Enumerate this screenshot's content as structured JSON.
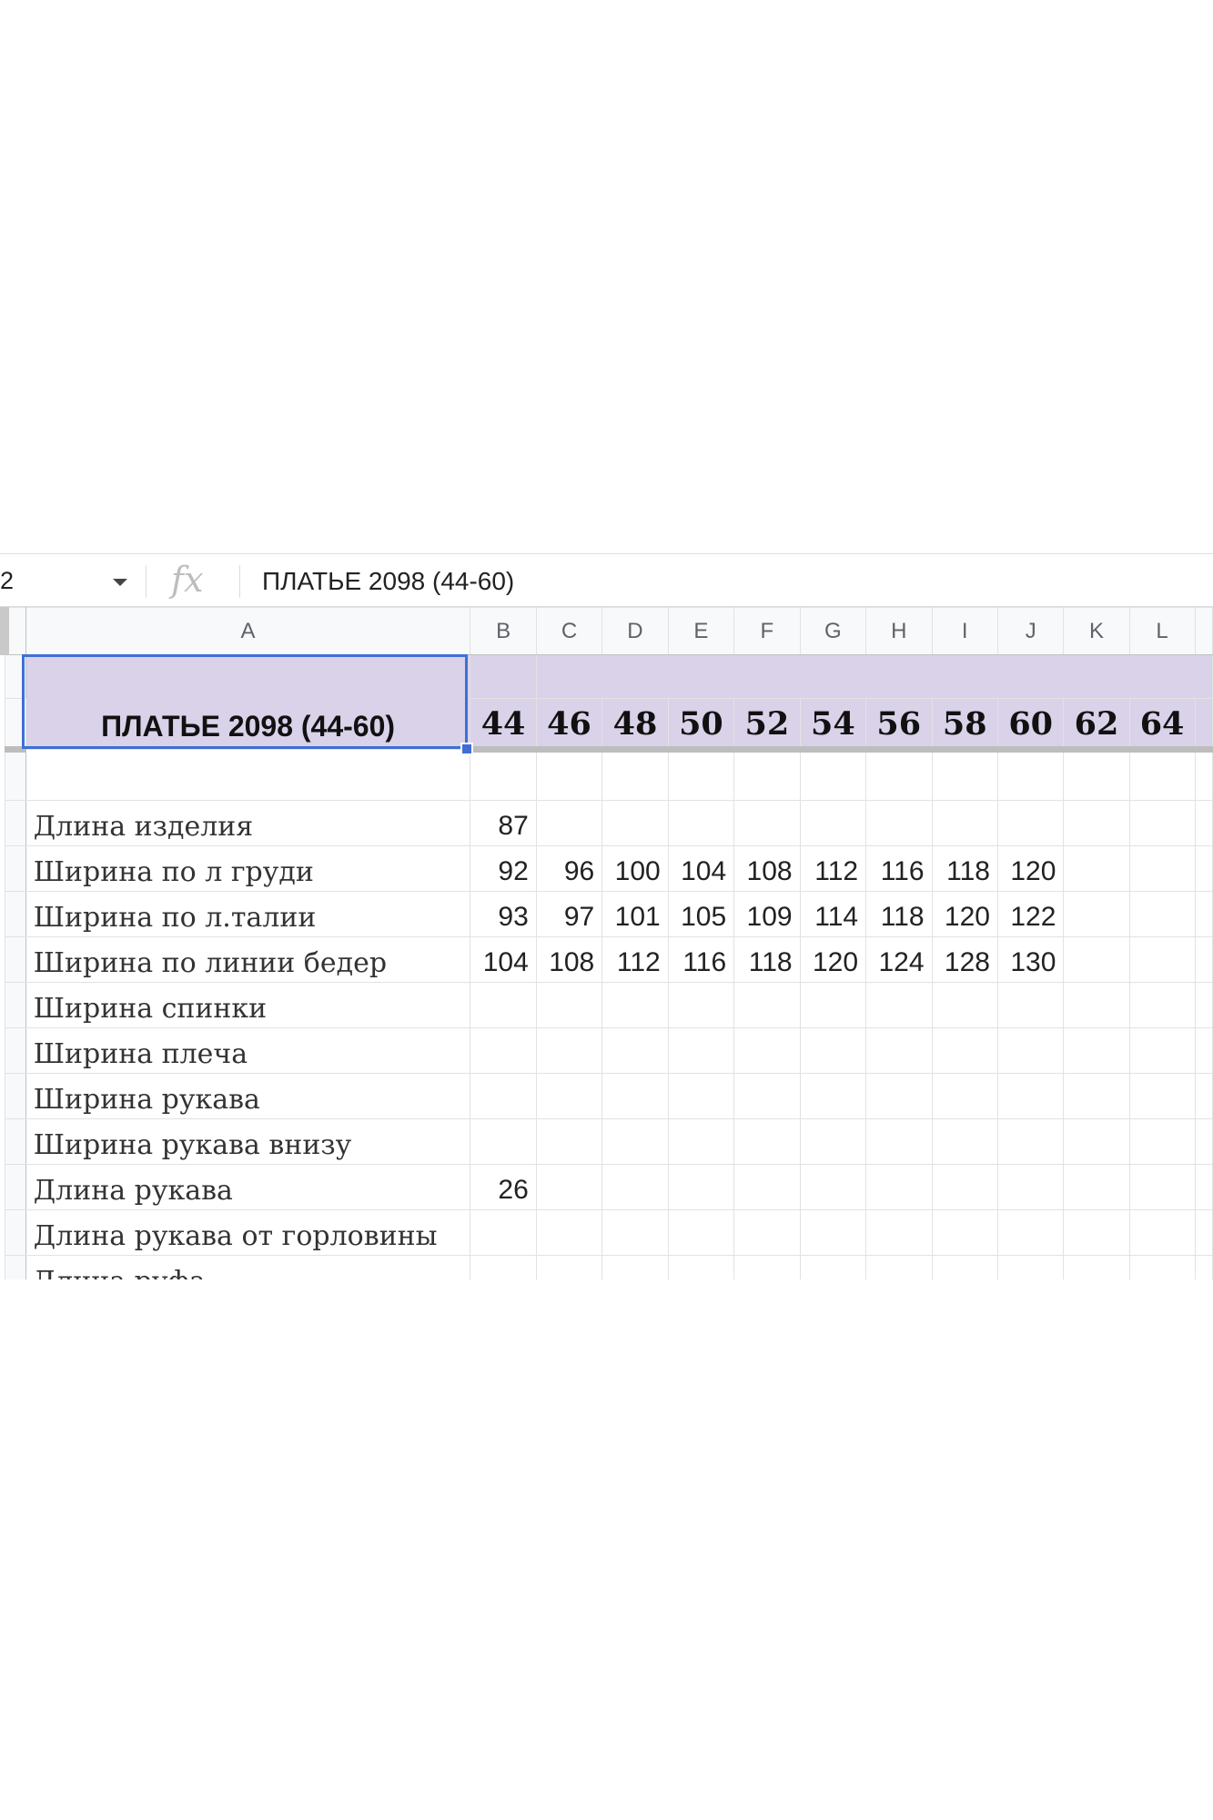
{
  "formula_bar": {
    "name_box": "2",
    "fx_label": "fx",
    "formula": "ПЛАТЬЕ 2098 (44-60)"
  },
  "columns": [
    "A",
    "B",
    "C",
    "D",
    "E",
    "F",
    "G",
    "H",
    "I",
    "J",
    "K",
    "L"
  ],
  "header": {
    "title": "ПЛАТЬЕ 2098 (44-60)",
    "sizes": [
      "44",
      "46",
      "48",
      "50",
      "52",
      "54",
      "56",
      "58",
      "60",
      "62",
      "64"
    ]
  },
  "rows": [
    {
      "label": "Длина изделия",
      "values": [
        "87",
        "",
        "",
        "",
        "",
        "",
        "",
        "",
        "",
        "",
        ""
      ]
    },
    {
      "label": "Ширина по л груди",
      "values": [
        "92",
        "96",
        "100",
        "104",
        "108",
        "112",
        "116",
        "118",
        "120",
        "",
        ""
      ]
    },
    {
      "label": "Ширина по л.талии",
      "values": [
        "93",
        "97",
        "101",
        "105",
        "109",
        "114",
        "118",
        "120",
        "122",
        "",
        ""
      ]
    },
    {
      "label": "Ширина по линии бедер",
      "values": [
        "104",
        "108",
        "112",
        "116",
        "118",
        "120",
        "124",
        "128",
        "130",
        "",
        ""
      ]
    },
    {
      "label": "Ширина спинки",
      "values": [
        "",
        "",
        "",
        "",
        "",
        "",
        "",
        "",
        "",
        "",
        ""
      ]
    },
    {
      "label": "Ширина плеча",
      "values": [
        "",
        "",
        "",
        "",
        "",
        "",
        "",
        "",
        "",
        "",
        ""
      ]
    },
    {
      "label": " Ширина рукава",
      "values": [
        "",
        "",
        "",
        "",
        "",
        "",
        "",
        "",
        "",
        "",
        ""
      ]
    },
    {
      "label": "Ширина рукава внизу",
      "values": [
        "",
        "",
        "",
        "",
        "",
        "",
        "",
        "",
        "",
        "",
        ""
      ]
    },
    {
      "label": "Длина рукава",
      "values": [
        "26",
        "",
        "",
        "",
        "",
        "",
        "",
        "",
        "",
        "",
        ""
      ]
    },
    {
      "label": "Длина рукава  от горловины",
      "values": [
        "",
        "",
        "",
        "",
        "",
        "",
        "",
        "",
        "",
        "",
        ""
      ]
    },
    {
      "label": "Длина руфа",
      "values": [
        "",
        "",
        "",
        "",
        "",
        "",
        "",
        "",
        "",
        "",
        ""
      ]
    }
  ]
}
